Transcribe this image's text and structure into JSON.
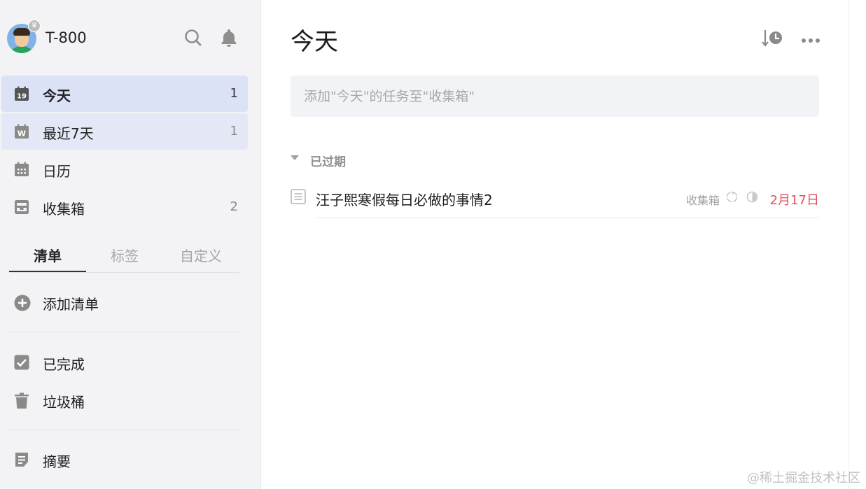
{
  "user": {
    "name": "T-800"
  },
  "nav": [
    {
      "label": "今天",
      "count": "1",
      "icon_text": "19"
    },
    {
      "label": "最近7天",
      "count": "1",
      "icon_text": "W"
    },
    {
      "label": "日历",
      "count": ""
    },
    {
      "label": "收集箱",
      "count": "2"
    }
  ],
  "tabs": [
    "清单",
    "标签",
    "自定义"
  ],
  "lists": {
    "add_label": "添加清单"
  },
  "system": [
    {
      "label": "已完成"
    },
    {
      "label": "垃圾桶"
    },
    {
      "label": "摘要"
    }
  ],
  "main": {
    "title": "今天",
    "add_placeholder": "添加\"今天\"的任务至\"收集箱\"",
    "section": "已过期",
    "task": {
      "title": "汪子熙寒假每日必做的事情2",
      "list": "收集箱",
      "date": "2月17日"
    }
  },
  "watermark": "@稀土掘金技术社区",
  "colors": {
    "accent_active": "#dce2f5",
    "overdue_date": "#e0525d",
    "sidebar_bg": "#f3f3f6"
  },
  "icons": [
    "search-icon",
    "bell-icon",
    "calendar-today-icon",
    "calendar-week-icon",
    "calendar-icon",
    "inbox-icon",
    "add-circle-icon",
    "checkbox-icon",
    "trash-icon",
    "summary-icon",
    "sort-clock-icon",
    "more-icon",
    "note-icon",
    "repeat-icon",
    "progress-icon"
  ]
}
